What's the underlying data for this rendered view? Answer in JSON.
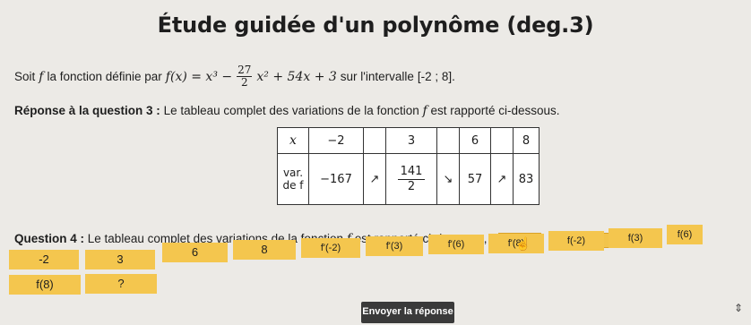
{
  "title": "Étude guidée d'un polynôme (deg.3)",
  "q1": {
    "prefix": "Soit",
    "f": "f",
    "text": "la fonction définie par",
    "fx": "f(x) = x³ −",
    "frac_num": "27",
    "frac_den": "2",
    "rest": "x² + 54x + 3",
    "interval_text": "sur l'intervalle",
    "interval": "[-2 ; 8]."
  },
  "q3": {
    "label": "Réponse à la question 3 :",
    "text": "Le tableau complet des variations de la fonction",
    "f": "f",
    "suffix": "est rapporté ci-dessous."
  },
  "table": {
    "x_label": "x",
    "x_values": [
      "−2",
      "3",
      "6",
      "8"
    ],
    "var_label": "var. de f",
    "v1": "−167",
    "arrow_up": "↗",
    "arrow_down": "↘",
    "v2_num": "141",
    "v2_den": "2",
    "v3": "57",
    "v4": "83"
  },
  "q4": {
    "label": "Question 4 :",
    "text": "Le tableau complet des variations de la fonction",
    "f": "f",
    "suffix": "est rapporté ci-dessous.,",
    "slot1": "?",
    "x_eq": "x =",
    "slot2": "?",
    "dot": "."
  },
  "choices": [
    "-2",
    "3",
    "6",
    "8",
    "f'(-2)",
    "f'(3)",
    "f'(6)",
    "f'(8)",
    "f(-2)",
    "f(3)",
    "f(6)",
    "f(8)",
    "?"
  ],
  "submit_label": "Envoyer la réponse",
  "accent": "#f4c64e"
}
